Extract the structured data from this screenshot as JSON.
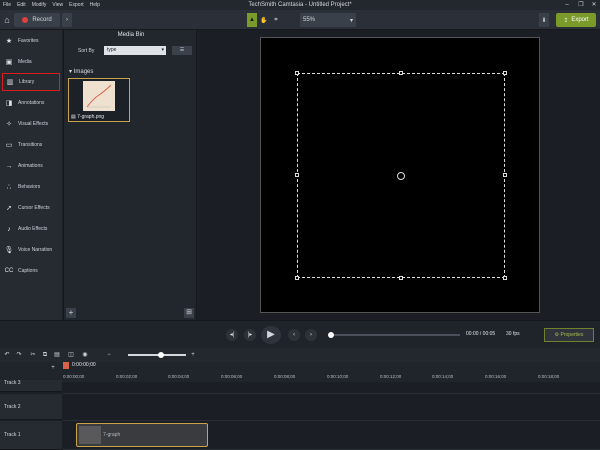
{
  "menu": [
    "File",
    "Edit",
    "Modify",
    "View",
    "Export",
    "Help"
  ],
  "app_title": "TechSmith Camtasia - Untitled Project*",
  "toolbar": {
    "record_label": "Record",
    "zoom_value": "55%",
    "export_label": "Export"
  },
  "sidebar": {
    "items": [
      {
        "label": "Favorites",
        "icon": "star-icon"
      },
      {
        "label": "Media",
        "icon": "media-icon"
      },
      {
        "label": "Library",
        "icon": "library-icon"
      },
      {
        "label": "Annotations",
        "icon": "annotation-icon"
      },
      {
        "label": "Visual Effects",
        "icon": "visual-effects-icon"
      },
      {
        "label": "Transitions",
        "icon": "transitions-icon"
      },
      {
        "label": "Animations",
        "icon": "animations-icon"
      },
      {
        "label": "Behaviors",
        "icon": "behaviors-icon"
      },
      {
        "label": "Cursor Effects",
        "icon": "cursor-icon"
      },
      {
        "label": "Audio Effects",
        "icon": "audio-icon"
      },
      {
        "label": "Voice Narration",
        "icon": "microphone-icon"
      },
      {
        "label": "Captions",
        "icon": "captions-icon"
      }
    ]
  },
  "media_bin": {
    "title": "Media Bin",
    "sort_by_label": "Sort By",
    "sort_value": "type",
    "group_label": "Images",
    "item_label": "7-graph.png"
  },
  "playback": {
    "time": "00:00 / 00:05",
    "fps": "30 fps",
    "properties_label": "Properties"
  },
  "timeline": {
    "playhead_time": "0:00:00;00",
    "ruler": [
      "0:00:00;00",
      "0:00:02;00",
      "0:00:04;00",
      "0:00:06;00",
      "0:00:08;00",
      "0:00:10;00",
      "0:00:12;00",
      "0:00:14;00",
      "0:00:16;00",
      "0:00:18;00"
    ],
    "tracks": [
      {
        "label": "Track 3"
      },
      {
        "label": "Track 2"
      },
      {
        "label": "Track 1"
      }
    ],
    "clip_label": "7-graph"
  },
  "colors": {
    "accent": "#c9a24a",
    "export_button": "#7a9a2a",
    "highlight_box": "#d91d1d",
    "record_dot": "#e0413a"
  }
}
